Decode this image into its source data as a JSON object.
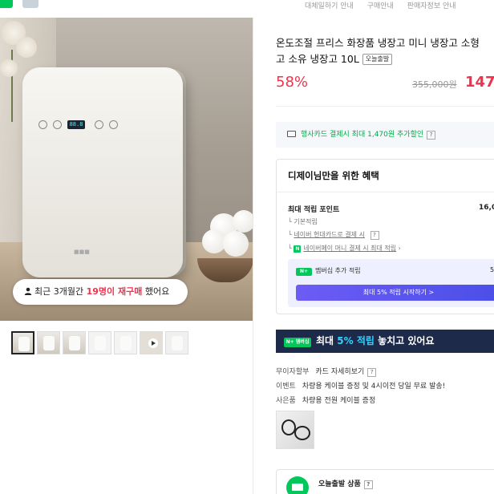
{
  "top_links": [
    "대체일하기 안내",
    "구매안내",
    "판매자정보 안내"
  ],
  "product": {
    "title_line1": "온도조절 프리스 화장품 냉장고 미니 냉장고 소형",
    "title_line2": "고 소유 냉장고 10L",
    "today_tag": "오늘출발",
    "discount": "58%",
    "original_price": "355,000원",
    "sale_price": "147,"
  },
  "hero": {
    "display_value": "88.8",
    "repurchase_prefix": "최근 3개월간 ",
    "repurchase_count": "19명이 재구매",
    "repurchase_suffix": " 했어요"
  },
  "card_benefit": {
    "prefix": "행사카드 결제시 최대 1,470원 추가할인",
    "help": "?"
  },
  "benefits": {
    "title": "디제이님만을 위한 혜택",
    "max_points_label": "최대 적립 포인트",
    "max_points_value": "16,0",
    "basic": "기본적립",
    "hyundai": "네이버 현대카드로 결제 시",
    "naverpay": "네이버페이 머니 결제 시 최대 적립",
    "member_label": "멤버십 추가 적립",
    "member_value": "5,",
    "member_button": "최대 5% 적립 시작하기 >",
    "n_icon": "N",
    "nplus_icon": "N+"
  },
  "banner": {
    "badge": "N+ 멤버십",
    "text_prefix": "최대 ",
    "text_highlight": "5% 적립",
    "text_suffix": " 놓치고 있어요"
  },
  "info": {
    "installment_label": "무이자할부",
    "installment_value": "카드 자세히보기",
    "event_label": "이벤트",
    "event_value": "차량용 케이블 증정 및 4시이전 당일 무료 발송!",
    "gift_label": "사은품",
    "gift_value": "차량용 전원 케이블 증정"
  },
  "today_box": {
    "label": "오늘출발 상품"
  },
  "colors": {
    "accent_red": "#f0324e",
    "naver_green": "#03c75a",
    "banner_bg": "#1e2a4a",
    "banner_highlight": "#33d2ff"
  }
}
